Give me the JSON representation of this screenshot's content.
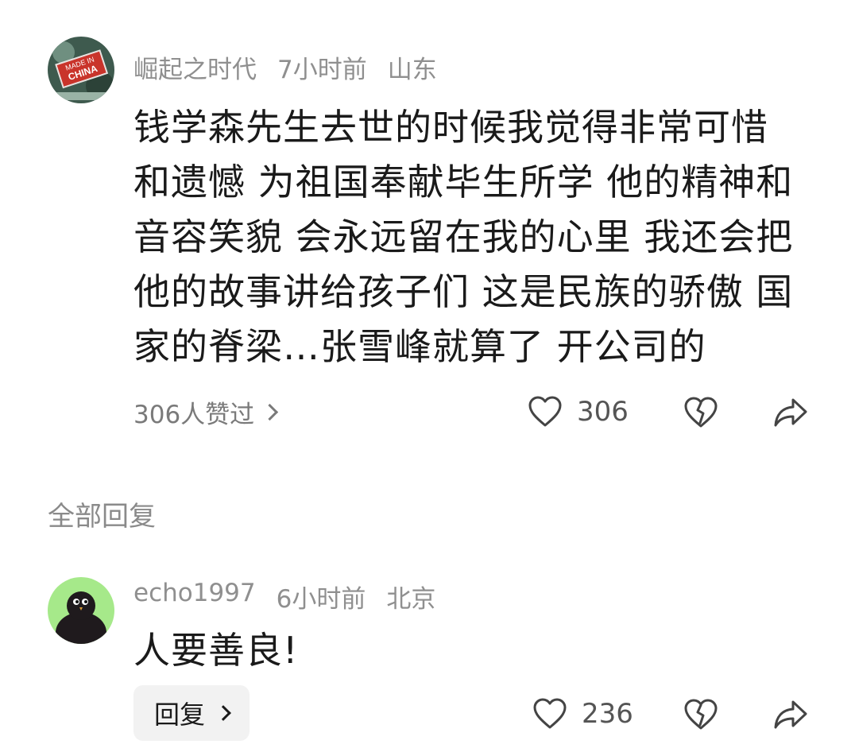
{
  "comment": {
    "username": "崛起之时代",
    "time": "7小时前",
    "location": "山东",
    "avatar_text_line1": "MADE IN",
    "avatar_text_line2": "CHINA",
    "text_lines": [
      "钱学森先生去世的时候我觉得非常可惜",
      "和遗憾 为祖国奉献毕生所学 他的精神和",
      "音容笑貌 会永远留在我的心里 我还会把",
      "他的故事讲给孩子们 这是民族的骄傲 国",
      "家的脊梁…张雪峰就算了 开公司的"
    ],
    "likers_label": "306人赞过",
    "like_count": "306"
  },
  "replies_section": {
    "title": "全部回复"
  },
  "reply": {
    "username": "echo1997",
    "time": "6小时前",
    "location": "北京",
    "text": "人要善良!",
    "reply_button_label": "回复",
    "like_count": "236"
  },
  "icons": [
    "heart-icon",
    "dislike-heart-icon",
    "share-icon",
    "chevron-right-icon"
  ],
  "colors": {
    "meta_gray": "#8f8f8f",
    "text_dark": "#1a1a1a",
    "reply_btn_bg": "#f2f2f2",
    "avatar2_bg": "#a6e98a"
  }
}
